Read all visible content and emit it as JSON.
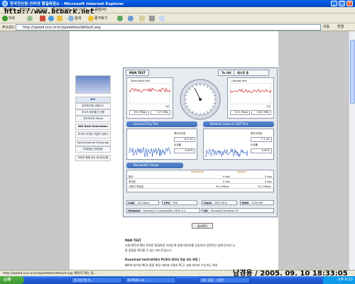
{
  "window": {
    "title": "한국전산원-인터넷 품질측정소 - Microsoft Internet Explorer"
  },
  "watermark": "http://www.bcpark.net",
  "menu": [
    "파일(F)",
    "편집(E)",
    "보기(V)",
    "즐겨찾기(A)",
    "도구(T)",
    "도움말(H)"
  ],
  "toolbar": {
    "back": "뒤로",
    "search": "검색",
    "favorites": "즐겨찾기"
  },
  "address": {
    "label": "주소(D)",
    "url": "http://speed.nca.or.kr/speedtest/default.asp",
    "go": "이동",
    "links": "연결"
  },
  "sidebar": {
    "items": [
      "BIX",
      "한국인터넷 교환노드",
      "초고속 정보통신 인증",
      "국가초고속 Portal",
      "NGI Next Generation",
      "초고속 국가망 가입자 서비스",
      "Korea Internet Exchange",
      "모범공공 인터넷망",
      "국민과 함께 하는 한국전산원"
    ]
  },
  "panel": {
    "tab_main": "MAN TEST",
    "tab_server": "To 서버",
    "tab_other": "테스트 중",
    "download": {
      "title": "Download test",
      "speed_label": "Mbps",
      "value1": "59.2 Mbps",
      "value2": "7.27 MBs",
      "axis": "시간"
    },
    "upload": {
      "title": "Upload test",
      "value1": "52.0 Mbps",
      "value2": "6.61 MBs",
      "axis": "시간"
    },
    "ping_header": "General Ping Test",
    "game_header": "Network Game & VoIP Test",
    "ping": {
      "label1": "평균지연값",
      "v1": "6.9 ms",
      "label2": "손실률",
      "v2": "0.00%"
    },
    "game": {
      "label1": "평균지연값",
      "v1": "7.1 ms",
      "label2": "손실률",
      "v2": "0.00%"
    },
    "bw_header": "Bandwidth Gauge",
    "table": {
      "col_dl": "Download",
      "col_ul": "Upload",
      "rows": [
        {
          "name": "평균",
          "dl": "0 bps",
          "ul": "0 bps"
        },
        {
          "name": "최대값",
          "dl": "0 bps",
          "ul": "0 bps"
        },
        {
          "name": "사용자 측정값",
          "dl": "59.2 Mbps",
          "ul": "52.0 Mbps"
        }
      ]
    },
    "info": {
      "lan_label": "LAN",
      "lan": "100 Mbps",
      "cpu_label": "CPU",
      "cpu": "996",
      "clock_label": "Clock",
      "clock": "2002 MHz",
      "ram_label": "RAM",
      "ram": "1024 MB",
      "browser_label": "Browser",
      "browser": "Mozilla/4.0 (compatible; MSIE 6.0",
      "os_label": "OS",
      "os": "Microsoft Windows XP"
    }
  },
  "result_button": "결과확인",
  "notes": {
    "n1_title": "MAN TEST",
    "n1_line1": "사용자PC와 NIA 위치한 품질측정 서버간에 실제 데이터를 전송하여 일련적인 실제 인터넷 사",
    "n1_line2": "용 품질을 확인할 수 있는 테스트입니다.",
    "n2_title": "Download test(서버에서 PC로의 데이터 전송 속도 측정 )",
    "n2_line1": "NIA에 위치한 NCA 품질 측정 서버에 사용자 PC간 실제 데이터 수신속도 측정"
  },
  "status": {
    "text": "http://speed.nca.or.kr/speedtest/default.asp 페이지 여는 중..."
  },
  "datestamp": "남경용 / 2005. 09. 10 18:33:05",
  "taskbar": {
    "start": "시작",
    "tasks": [
      "한국전산원-인...",
      "BCPARK.net - ...",
      "일부 검출 - 그림판"
    ],
    "clock": "오후 6:33"
  },
  "colors": {
    "graph_line": "#d04040",
    "ping_line": "#3060c0",
    "accent": "#3e6cb8"
  }
}
